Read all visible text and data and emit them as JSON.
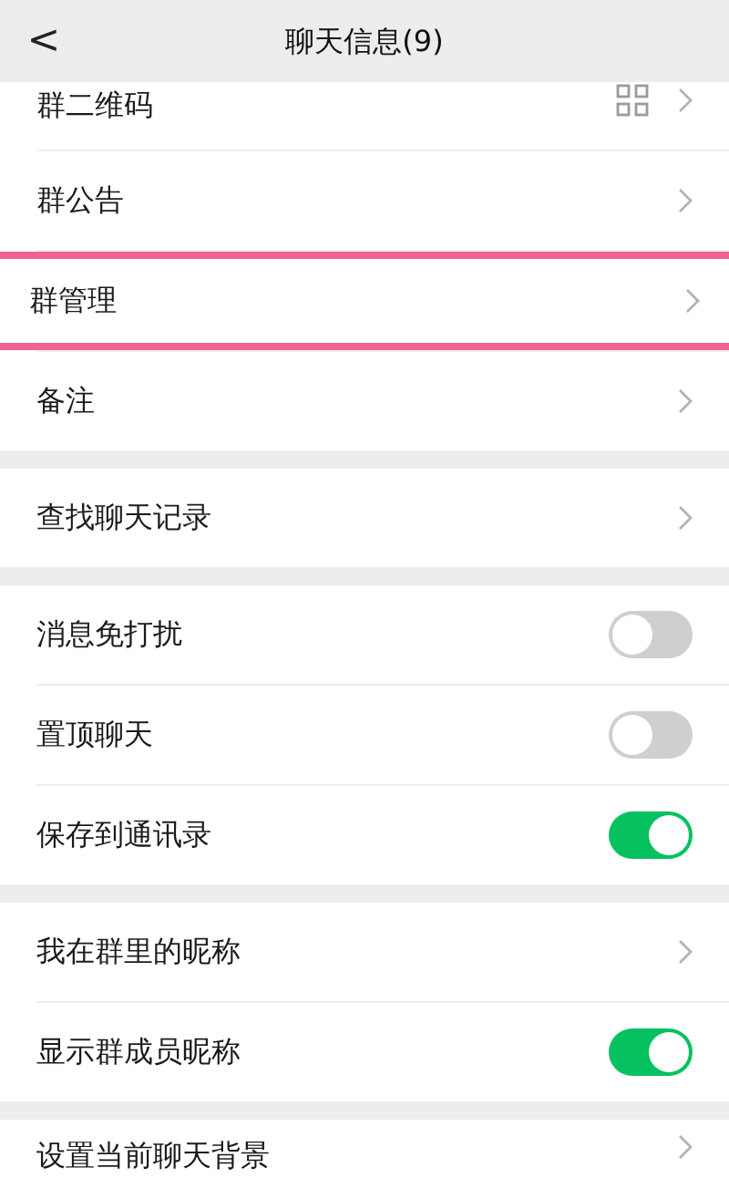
{
  "header": {
    "back": "<",
    "title": "聊天信息(9)"
  },
  "groups": [
    {
      "items": [
        {
          "kind": "qr",
          "label": "群二维码",
          "highlighted": false
        },
        {
          "kind": "link",
          "label": "群公告",
          "highlighted": false
        },
        {
          "kind": "link",
          "label": "群管理",
          "highlighted": true
        },
        {
          "kind": "link",
          "label": "备注",
          "highlighted": false
        }
      ]
    },
    {
      "items": [
        {
          "kind": "link",
          "label": "查找聊天记录",
          "highlighted": false
        }
      ]
    },
    {
      "items": [
        {
          "kind": "toggle",
          "label": "消息免打扰",
          "on": false
        },
        {
          "kind": "toggle",
          "label": "置顶聊天",
          "on": false
        },
        {
          "kind": "toggle",
          "label": "保存到通讯录",
          "on": true
        }
      ]
    },
    {
      "items": [
        {
          "kind": "link",
          "label": "我在群里的昵称",
          "highlighted": false
        },
        {
          "kind": "toggle",
          "label": "显示群成员昵称",
          "on": true
        }
      ]
    },
    {
      "items": [
        {
          "kind": "link",
          "label": "设置当前聊天背景",
          "highlighted": false
        }
      ]
    }
  ]
}
